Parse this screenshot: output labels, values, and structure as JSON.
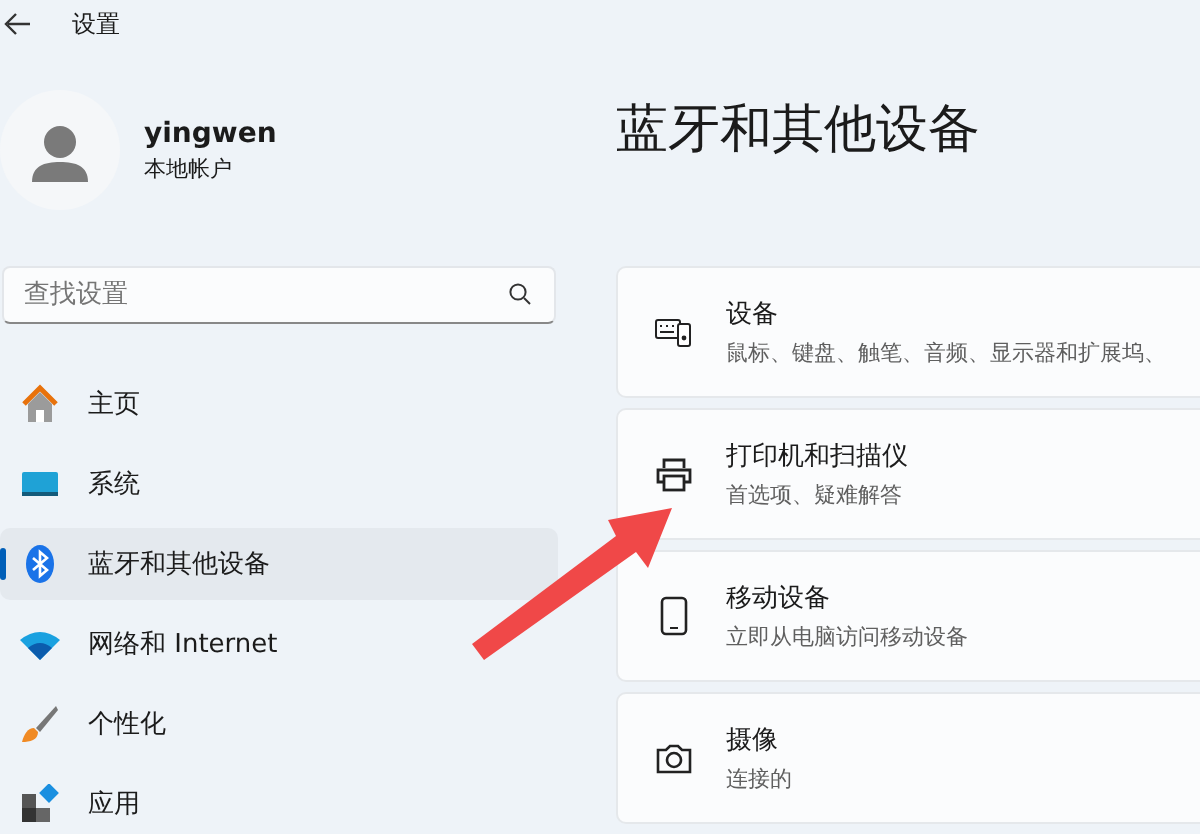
{
  "window": {
    "title": "设置"
  },
  "account": {
    "name": "yingwen",
    "type": "本地帐户"
  },
  "search": {
    "placeholder": "查找设置"
  },
  "nav": [
    {
      "label": "主页",
      "kind": "home",
      "selected": false
    },
    {
      "label": "系统",
      "kind": "system",
      "selected": false
    },
    {
      "label": "蓝牙和其他设备",
      "kind": "bluetooth",
      "selected": true
    },
    {
      "label": "网络和 Internet",
      "kind": "wifi",
      "selected": false
    },
    {
      "label": "个性化",
      "kind": "brush",
      "selected": false
    },
    {
      "label": "应用",
      "kind": "apps",
      "selected": false
    }
  ],
  "page": {
    "title": "蓝牙和其他设备"
  },
  "cards": [
    {
      "title": "设备",
      "subtitle": "鼠标、键盘、触笔、音频、显示器和扩展坞、",
      "kind": "devices"
    },
    {
      "title": "打印机和扫描仪",
      "subtitle": "首选项、疑难解答",
      "kind": "printer"
    },
    {
      "title": "移动设备",
      "subtitle": "立即从电脑访问移动设备",
      "kind": "phone"
    },
    {
      "title": "摄像",
      "subtitle": "连接的",
      "kind": "camera"
    }
  ]
}
